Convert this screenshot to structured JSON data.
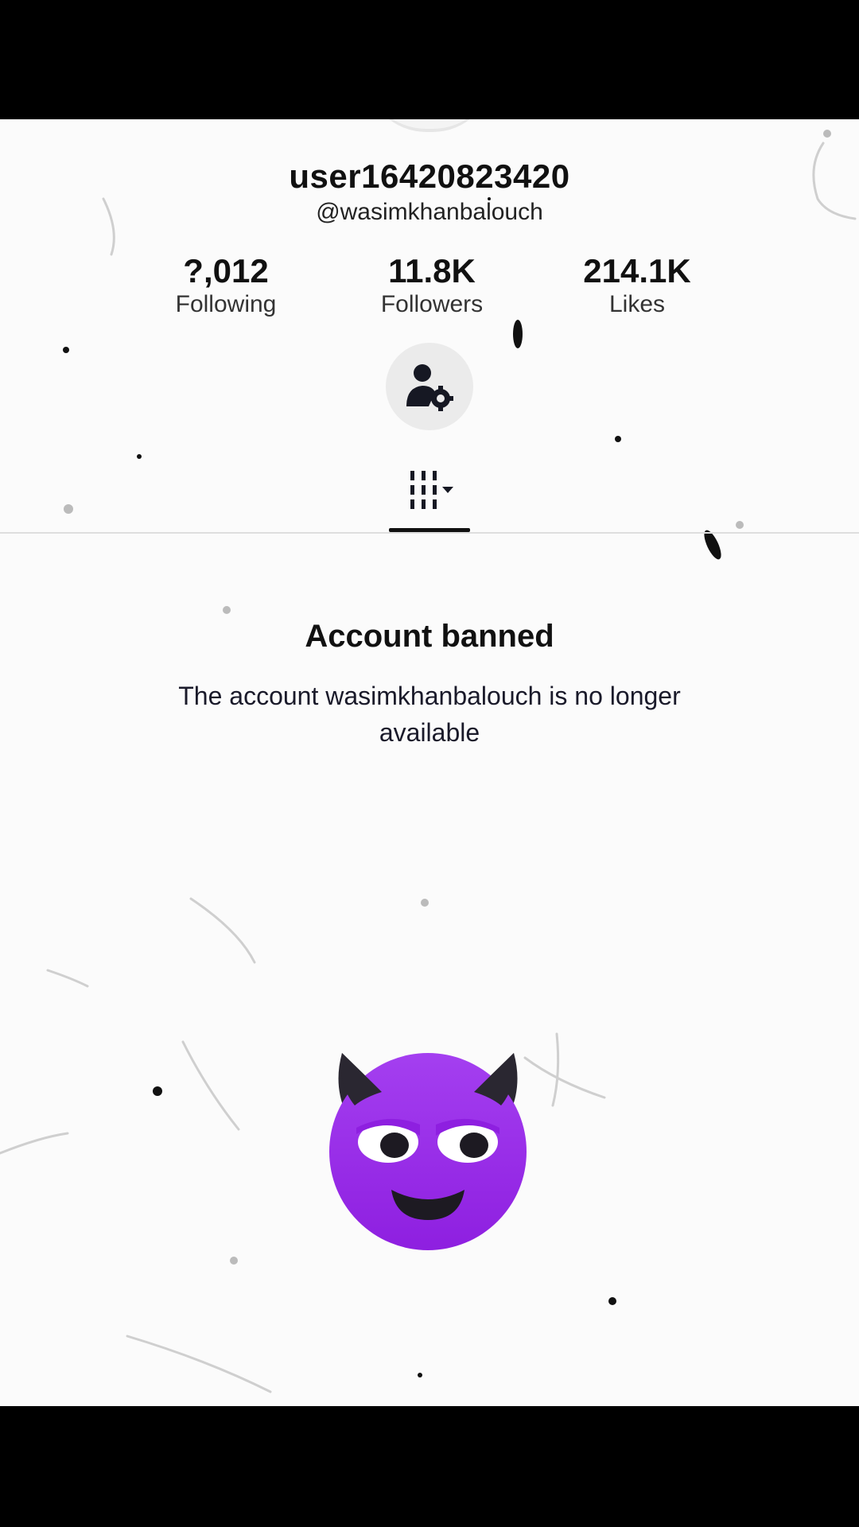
{
  "profile": {
    "username": "user16420823420",
    "handle": "@wasimkhanbalouch"
  },
  "stats": [
    {
      "value": "?,012",
      "label": "Following"
    },
    {
      "value": "11.8K",
      "label": "Followers"
    },
    {
      "value": "214.1K",
      "label": "Likes"
    }
  ],
  "actions": {
    "friends_icon": "add-friends-icon"
  },
  "tabs": {
    "videos_icon": "grid-videos-icon"
  },
  "notice": {
    "title": "Account banned",
    "message": "The account wasimkhanbalouch is no longer available"
  },
  "sticker": {
    "icon": "smiling-devil-emoji",
    "color": "#9c27e8"
  }
}
